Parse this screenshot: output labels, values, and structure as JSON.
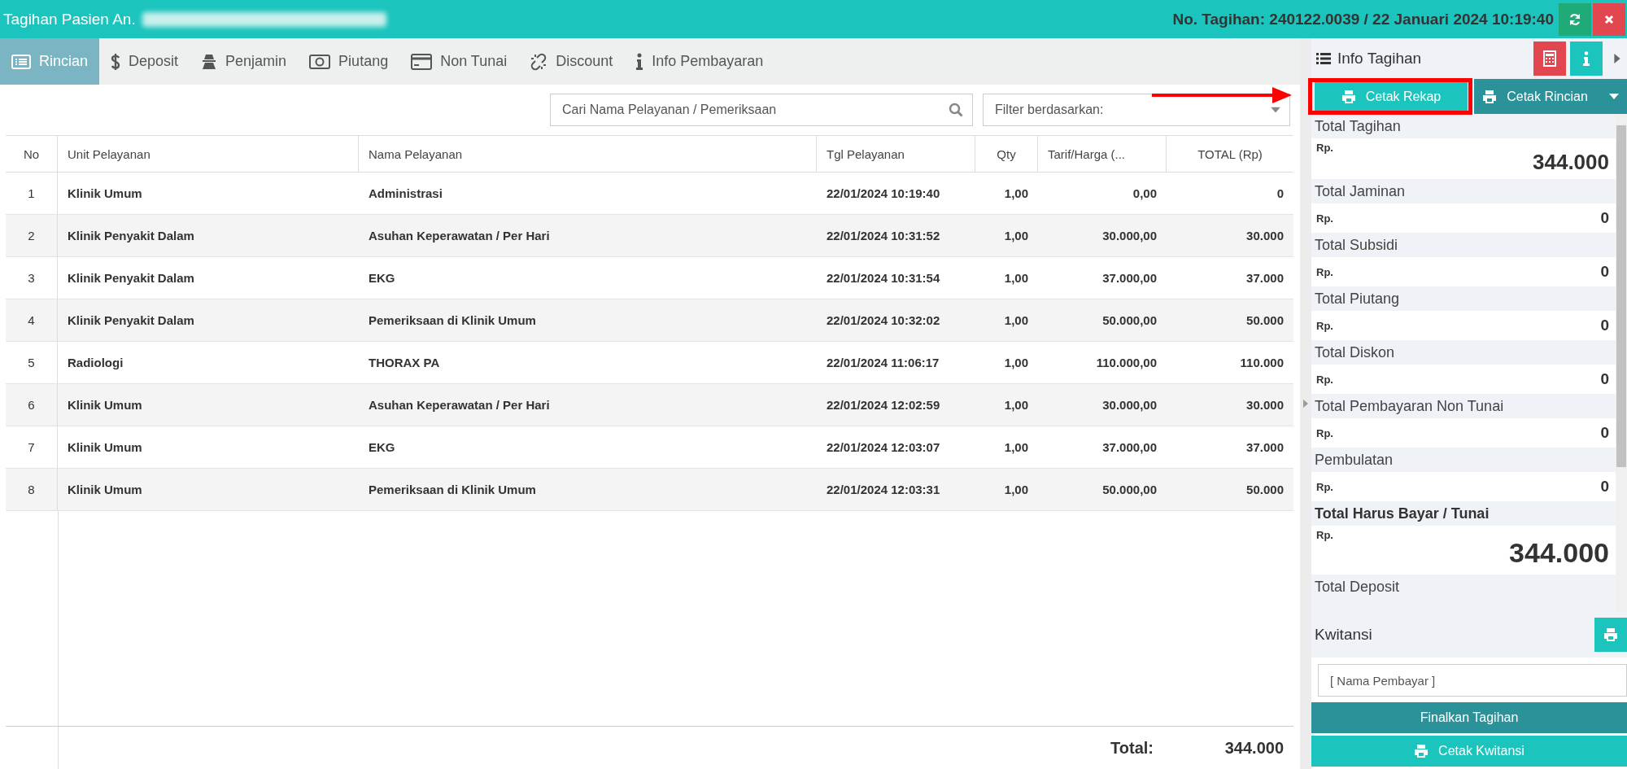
{
  "header": {
    "title": "Tagihan Pasien An.",
    "bill_info": "No. Tagihan: 240122.0039 / 22 Januari 2024 10:19:40"
  },
  "tabs": [
    {
      "label": "Rincian",
      "selected": true
    },
    {
      "label": "Deposit",
      "selected": false
    },
    {
      "label": "Penjamin",
      "selected": false
    },
    {
      "label": "Piutang",
      "selected": false
    },
    {
      "label": "Non Tunai",
      "selected": false
    },
    {
      "label": "Discount",
      "selected": false
    },
    {
      "label": "Info Pembayaran",
      "selected": false
    }
  ],
  "search": {
    "placeholder": "Cari Nama Pelayanan / Pemeriksaan"
  },
  "filter": {
    "placeholder": "Filter berdasarkan:"
  },
  "table": {
    "columns": [
      "No",
      "Unit Pelayanan",
      "Nama Pelayanan",
      "Tgl Pelayanan",
      "Qty",
      "Tarif/Harga (...",
      "TOTAL (Rp)"
    ],
    "rows": [
      [
        "1",
        "Klinik Umum",
        "Administrasi",
        "22/01/2024 10:19:40",
        "1,00",
        "0,00",
        "0"
      ],
      [
        "2",
        "Klinik Penyakit Dalam",
        "Asuhan Keperawatan / Per Hari",
        "22/01/2024 10:31:52",
        "1,00",
        "30.000,00",
        "30.000"
      ],
      [
        "3",
        "Klinik Penyakit Dalam",
        "EKG",
        "22/01/2024 10:31:54",
        "1,00",
        "37.000,00",
        "37.000"
      ],
      [
        "4",
        "Klinik Penyakit Dalam",
        "Pemeriksaan di Klinik Umum",
        "22/01/2024 10:32:02",
        "1,00",
        "50.000,00",
        "50.000"
      ],
      [
        "5",
        "Radiologi",
        "THORAX PA",
        "22/01/2024 11:06:17",
        "1,00",
        "110.000,00",
        "110.000"
      ],
      [
        "6",
        "Klinik Umum",
        "Asuhan Keperawatan / Per Hari",
        "22/01/2024 12:02:59",
        "1,00",
        "30.000,00",
        "30.000"
      ],
      [
        "7",
        "Klinik Umum",
        "EKG",
        "22/01/2024 12:03:07",
        "1,00",
        "37.000,00",
        "37.000"
      ],
      [
        "8",
        "Klinik Umum",
        "Pemeriksaan di Klinik Umum",
        "22/01/2024 12:03:31",
        "1,00",
        "50.000,00",
        "50.000"
      ]
    ],
    "footer": {
      "label": "Total:",
      "value": "344.000"
    }
  },
  "info_panel": {
    "title": "Info Tagihan",
    "print_recap": "Cetak Rekap",
    "print_detail": "Cetak Rincian",
    "items": [
      {
        "kind": "total",
        "label": "Total Tagihan",
        "currency": "Rp.",
        "value": "344.000"
      },
      {
        "kind": "normal",
        "label": "Total Jaminan",
        "currency": "Rp.",
        "value": "0"
      },
      {
        "kind": "normal",
        "label": "Total Subsidi",
        "currency": "Rp.",
        "value": "0"
      },
      {
        "kind": "normal",
        "label": "Total Piutang",
        "currency": "Rp.",
        "value": "0"
      },
      {
        "kind": "normal",
        "label": "Total Diskon",
        "currency": "Rp.",
        "value": "0"
      },
      {
        "kind": "normal",
        "label": "Total Pembayaran Non Tunai",
        "currency": "Rp.",
        "value": "0"
      },
      {
        "kind": "normal",
        "label": "Pembulatan",
        "currency": "Rp.",
        "value": "0"
      },
      {
        "kind": "grand",
        "label": "Total Harus Bayar / Tunai",
        "currency": "Rp.",
        "value": "344.000"
      },
      {
        "kind": "label",
        "label": "Total Deposit"
      }
    ],
    "receipt": {
      "title": "Kwitansi",
      "payer_placeholder": "[ Nama Pembayar ]",
      "finalize": "Finalkan Tagihan",
      "print_receipt": "Cetak Kwitansi"
    }
  }
}
